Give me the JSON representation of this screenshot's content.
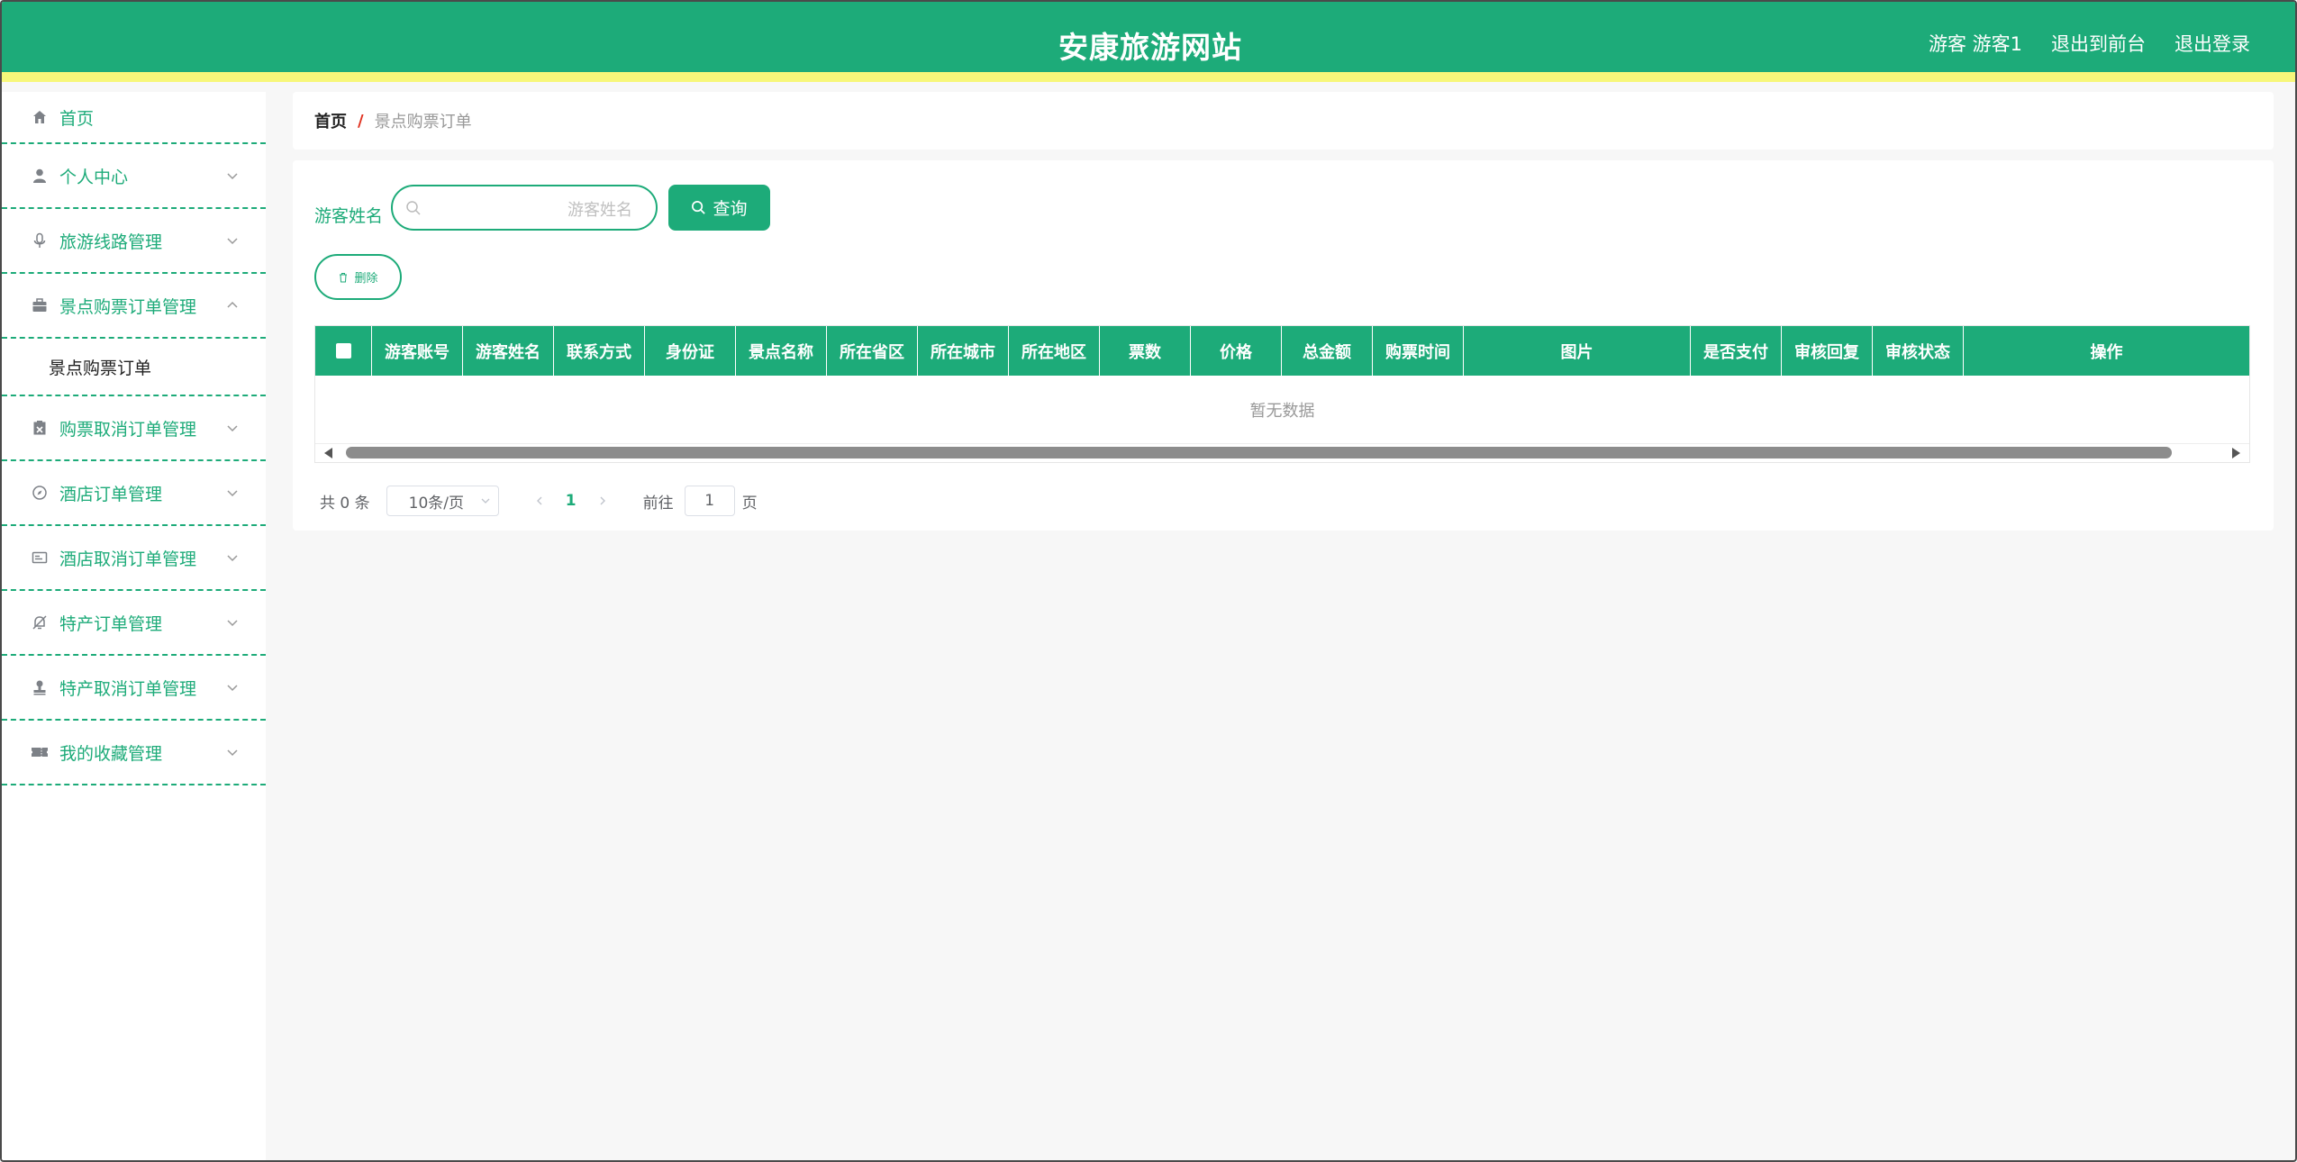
{
  "header": {
    "title": "安康旅游网站",
    "user": "游客 游客1",
    "back_to_front": "退出到前台",
    "logout": "退出登录"
  },
  "sidebar": {
    "items": [
      {
        "label": "首页",
        "icon": "home-icon"
      },
      {
        "label": "个人中心",
        "icon": "user-icon"
      },
      {
        "label": "旅游线路管理",
        "icon": "microphone-icon"
      },
      {
        "label": "景点购票订单管理",
        "icon": "briefcase-icon",
        "expanded": true,
        "sub": [
          "景点购票订单"
        ]
      },
      {
        "label": "购票取消订单管理",
        "icon": "clipboard-x-icon"
      },
      {
        "label": "酒店订单管理",
        "icon": "compass-icon"
      },
      {
        "label": "酒店取消订单管理",
        "icon": "card-icon"
      },
      {
        "label": "特产订单管理",
        "icon": "bell-off-icon"
      },
      {
        "label": "特产取消订单管理",
        "icon": "stamp-icon"
      },
      {
        "label": "我的收藏管理",
        "icon": "ticket-icon"
      }
    ]
  },
  "breadcrumb": {
    "home": "首页",
    "separator": "/",
    "current": "景点购票订单"
  },
  "search": {
    "label": "游客姓名",
    "placeholder": "游客姓名",
    "query_button": "查询"
  },
  "actions": {
    "delete_button": "删除"
  },
  "table": {
    "columns": [
      "游客账号",
      "游客姓名",
      "联系方式",
      "身份证",
      "景点名称",
      "所在省区",
      "所在城市",
      "所在地区",
      "票数",
      "价格",
      "总金额",
      "购票时间",
      "图片",
      "是否支付",
      "审核回复",
      "审核状态",
      "操作"
    ],
    "empty_text": "暂无数据"
  },
  "pagination": {
    "total": "共 0 条",
    "page_size": "10条/页",
    "current_page": "1",
    "goto_label": "前往",
    "goto_value": "1",
    "page_unit": "页"
  },
  "colors": {
    "accent": "#1dab79",
    "header_stripe": "#f7f77a",
    "breadcrumb_separator": "#e0301e"
  }
}
